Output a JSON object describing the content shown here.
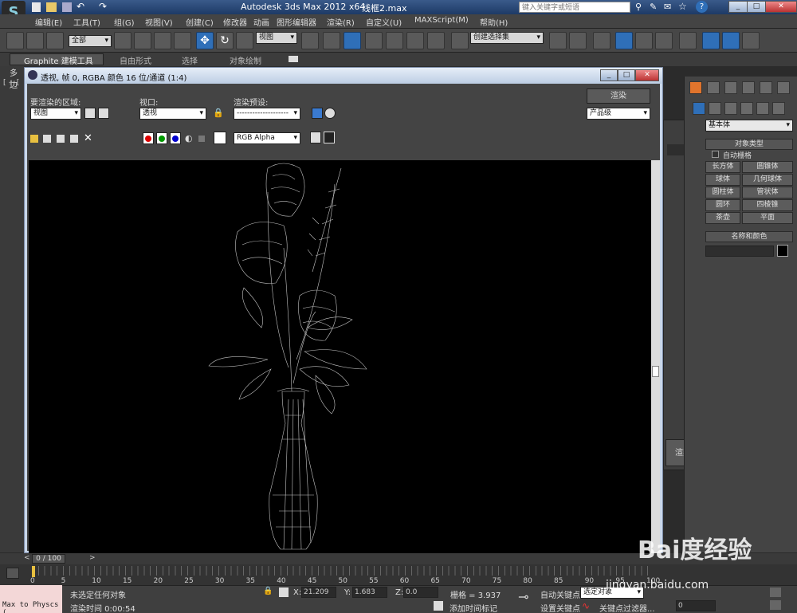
{
  "app": {
    "title": "Autodesk 3ds Max  2012 x64",
    "file": "线框2.max",
    "search_placeholder": "键入关键字或短语"
  },
  "menu": [
    "编辑(E)",
    "工具(T)",
    "组(G)",
    "视图(V)",
    "创建(C)",
    "修改器",
    "动画",
    "图形编辑器",
    "渲染(R)",
    "自定义(U)",
    "MAXScript(M)",
    "帮助(H)"
  ],
  "toolbar": {
    "filter_value": "全部",
    "refcoord_value": "视图",
    "selection_set": "创建选择集"
  },
  "ribbon": {
    "tabs": [
      "Graphite 建模工具",
      "自由形式",
      "选择",
      "对象绘制"
    ]
  },
  "viewport_label": "[ + [",
  "left_strip_label": "多边",
  "render_window": {
    "title": "透视, 帧 0, RGBA 颜色 16 位/通道 (1:4)",
    "area_label": "要渲染的区域:",
    "area_value": "视图",
    "viewport_label": "视口:",
    "viewport_value": "透视",
    "preset_label": "渲染预设:",
    "preset_value": "--------------------",
    "render_button": "渲染",
    "quality_value": "产品级",
    "channel_value": "RGB Alpha"
  },
  "command_panel": {
    "category": "基本体",
    "object_type_header": "对象类型",
    "autogrid": "自动栅格",
    "buttons": [
      "长方体",
      "圆锥体",
      "球体",
      "几何球体",
      "圆柱体",
      "管状体",
      "圆环",
      "四棱锥",
      "茶壶",
      "平面"
    ],
    "name_color_header": "名称和颜色"
  },
  "back_dialog": {
    "render_label": "渲染"
  },
  "timeline": {
    "frame": "0 / 100",
    "ticks": [
      "0",
      "5",
      "10",
      "15",
      "20",
      "25",
      "30",
      "35",
      "40",
      "45",
      "50",
      "55",
      "60",
      "65",
      "70",
      "75",
      "80",
      "85",
      "90",
      "95",
      "100"
    ]
  },
  "status": {
    "max_to_physx": "Max to Physcs (",
    "selection": "未选定任何对象",
    "x_label": "X:",
    "x_value": "21.209",
    "y_label": "Y:",
    "y_value": "1.683",
    "z_label": "Z:",
    "z_value": "0.0",
    "grid": "栅格 = 3.937",
    "autokey": "自动关键点",
    "autokey_select": "选定对象",
    "setkey": "设置关键点",
    "key_filter": "关键点过滤器...",
    "render_time": "渲染时间  0:00:54",
    "add_time_tag": "添加时间标记",
    "frame_value": "0"
  },
  "watermark": {
    "main": "Bai度经验",
    "url": "jingyan.baidu.com"
  },
  "colors": {
    "accent": "#2f6fb8",
    "title_gradient_top": "#3a5a8a",
    "render_bg": "#000000"
  }
}
